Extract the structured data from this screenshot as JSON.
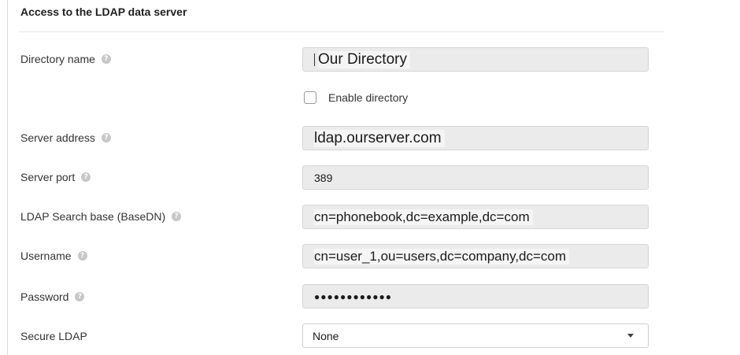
{
  "section": {
    "title": "Access to the LDAP data server"
  },
  "help_glyph": "?",
  "fields": {
    "directory_name": {
      "label": "Directory name",
      "value": "Our Directory"
    },
    "enable_directory": {
      "label": "Enable directory",
      "checked": false
    },
    "server_address": {
      "label": "Server address",
      "value": "ldap.ourserver.com"
    },
    "server_port": {
      "label": "Server port",
      "value": "389"
    },
    "search_base": {
      "label": "LDAP Search base (BaseDN)",
      "value": "cn=phonebook,dc=example,dc=com"
    },
    "username": {
      "label": "Username",
      "value": "cn=user_1,ou=users,dc=company,dc=com"
    },
    "password": {
      "label": "Password",
      "value": "●●●●●●●●●●●●"
    },
    "secure_ldap": {
      "label": "Secure LDAP",
      "value": "None"
    }
  },
  "icons": {
    "help": "help-circle-icon",
    "dropdown": "chevron-down-icon"
  }
}
